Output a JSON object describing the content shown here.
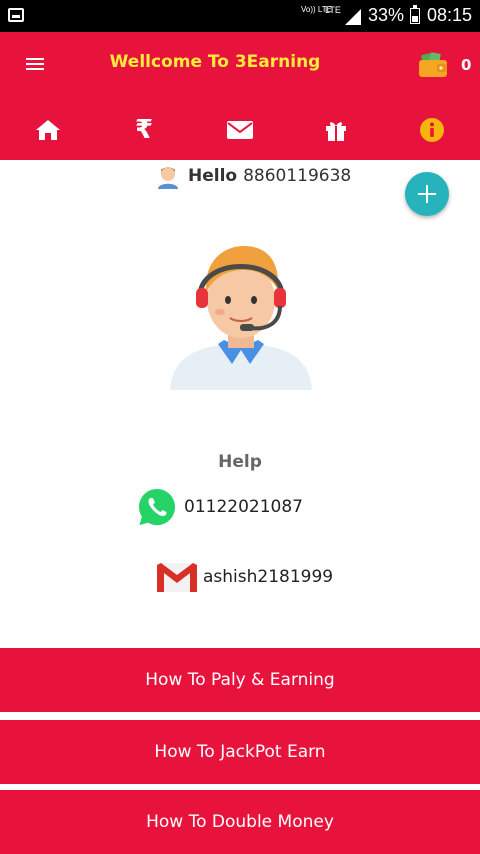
{
  "status_bar": {
    "volte": "Vo)) LTE",
    "lte": "LTE",
    "battery_percent": "33%",
    "time": "08:15"
  },
  "header": {
    "title": "Wellcome To 3Earning",
    "wallet_count": "0",
    "nav": [
      {
        "icon": "home-icon"
      },
      {
        "icon": "rupee-icon",
        "glyph": "₹"
      },
      {
        "icon": "mail-icon"
      },
      {
        "icon": "gift-icon"
      },
      {
        "icon": "info-icon"
      }
    ]
  },
  "greeting": {
    "label": "Hello",
    "phone": "8860119638"
  },
  "help": {
    "title": "Help",
    "whatsapp": "01122021087",
    "email": "ashish2181999"
  },
  "actions": [
    {
      "label": "How To Paly &  Earning"
    },
    {
      "label": "How To JackPot Earn"
    },
    {
      "label": "How To Double Money"
    }
  ],
  "colors": {
    "primary": "#e8133c",
    "title_yellow": "#ffeb3b",
    "fab": "#26b3bb",
    "info_badge": "#f5b50a"
  }
}
